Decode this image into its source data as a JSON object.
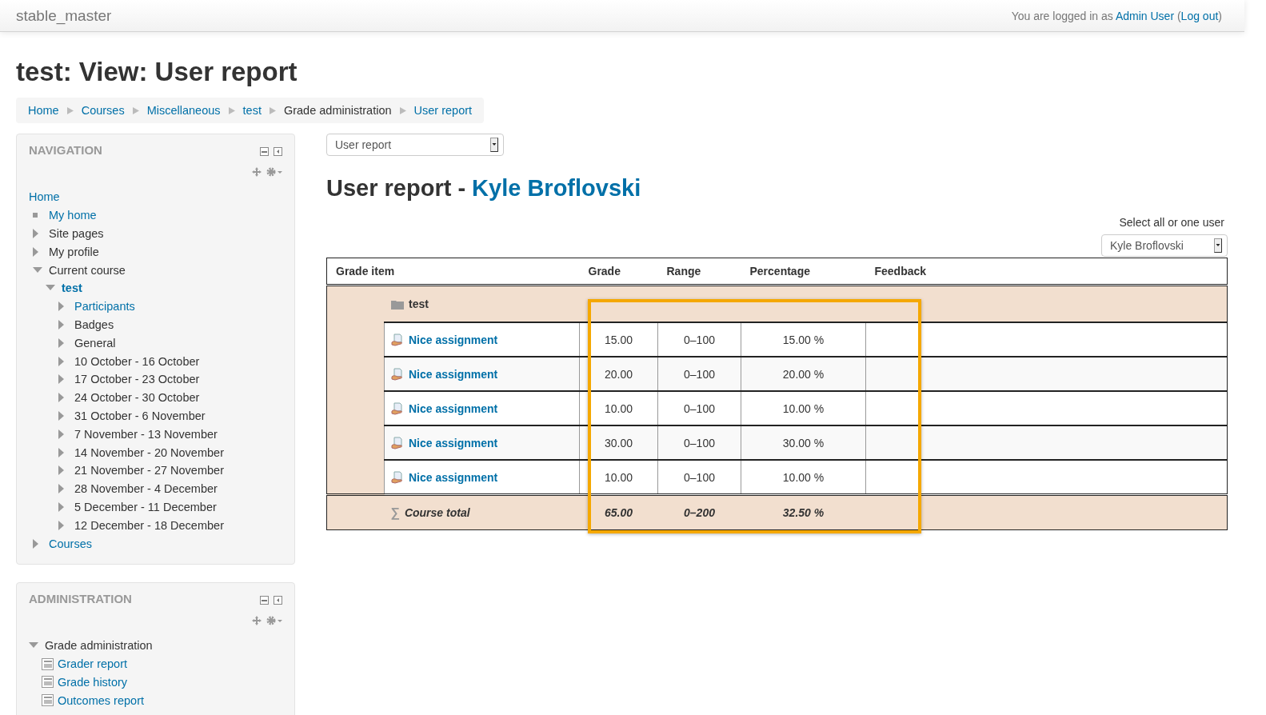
{
  "header": {
    "site_name": "stable_master",
    "login": [
      {
        "text": "You are logged in as ",
        "link": false
      },
      {
        "text": "Admin User",
        "link": true
      },
      {
        "text": " (",
        "link": false
      },
      {
        "text": "Log out",
        "link": true
      },
      {
        "text": ")",
        "link": false
      }
    ]
  },
  "page_title": "test: View: User report",
  "breadcrumb": [
    {
      "label": "Home",
      "link": true
    },
    {
      "label": "Courses",
      "link": true
    },
    {
      "label": "Miscellaneous",
      "link": true
    },
    {
      "label": "test",
      "link": true
    },
    {
      "label": "Grade administration",
      "link": false
    },
    {
      "label": "User report",
      "link": true
    }
  ],
  "blocks": [
    {
      "title": "NAVIGATION",
      "items": [
        {
          "label": "Home",
          "kind": "none",
          "link": true,
          "selected": false,
          "children": [
            {
              "label": "My home",
              "kind": "bullet",
              "link": true,
              "selected": false
            },
            {
              "label": "Site pages",
              "kind": "branch",
              "expanded": false,
              "link": false,
              "selected": false
            },
            {
              "label": "My profile",
              "kind": "branch",
              "expanded": false,
              "link": false,
              "selected": false
            },
            {
              "label": "Current course",
              "kind": "branch",
              "expanded": true,
              "link": false,
              "selected": false,
              "children": [
                {
                  "label": "test",
                  "kind": "branch",
                  "expanded": true,
                  "link": true,
                  "selected": true,
                  "children": [
                    {
                      "label": "Participants",
                      "kind": "branch",
                      "expanded": false,
                      "link": true,
                      "selected": false
                    },
                    {
                      "label": "Badges",
                      "kind": "branch",
                      "expanded": false,
                      "link": false,
                      "selected": false
                    },
                    {
                      "label": "General",
                      "kind": "branch",
                      "expanded": false,
                      "link": false,
                      "selected": false
                    },
                    {
                      "label": "10 October - 16 October",
                      "kind": "branch",
                      "expanded": false,
                      "link": false,
                      "selected": false
                    },
                    {
                      "label": "17 October - 23 October",
                      "kind": "branch",
                      "expanded": false,
                      "link": false,
                      "selected": false
                    },
                    {
                      "label": "24 October - 30 October",
                      "kind": "branch",
                      "expanded": false,
                      "link": false,
                      "selected": false
                    },
                    {
                      "label": "31 October - 6 November",
                      "kind": "branch",
                      "expanded": false,
                      "link": false,
                      "selected": false
                    },
                    {
                      "label": "7 November - 13 November",
                      "kind": "branch",
                      "expanded": false,
                      "link": false,
                      "selected": false
                    },
                    {
                      "label": "14 November - 20 November",
                      "kind": "branch",
                      "expanded": false,
                      "link": false,
                      "selected": false
                    },
                    {
                      "label": "21 November - 27 November",
                      "kind": "branch",
                      "expanded": false,
                      "link": false,
                      "selected": false
                    },
                    {
                      "label": "28 November - 4 December",
                      "kind": "branch",
                      "expanded": false,
                      "link": false,
                      "selected": false
                    },
                    {
                      "label": "5 December - 11 December",
                      "kind": "branch",
                      "expanded": false,
                      "link": false,
                      "selected": false
                    },
                    {
                      "label": "12 December - 18 December",
                      "kind": "branch",
                      "expanded": false,
                      "link": false,
                      "selected": false
                    }
                  ]
                }
              ]
            },
            {
              "label": "Courses",
              "kind": "branch",
              "expanded": false,
              "link": true,
              "selected": false
            }
          ]
        }
      ]
    },
    {
      "title": "ADMINISTRATION",
      "items": [
        {
          "label": "Grade administration",
          "kind": "branch",
          "expanded": true,
          "link": false,
          "selected": false,
          "children": [
            {
              "label": "Grader report",
              "kind": "report",
              "link": true,
              "selected": false
            },
            {
              "label": "Grade history",
              "kind": "report",
              "link": true,
              "selected": false
            },
            {
              "label": "Outcomes report",
              "kind": "report",
              "link": true,
              "selected": false
            }
          ]
        }
      ]
    }
  ],
  "report_select": {
    "value": "User report"
  },
  "report_heading": {
    "text": "User report - ",
    "user": "Kyle Broflovski"
  },
  "user_select": {
    "label": "Select all or one user",
    "value": "Kyle Broflovski"
  },
  "table": {
    "columns": [
      "Grade item",
      "Grade",
      "Range",
      "Percentage",
      "Feedback"
    ],
    "category": "test",
    "rows": [
      {
        "item": "Nice assignment",
        "grade": "15.00",
        "range": "0–100",
        "percentage": "15.00 %"
      },
      {
        "item": "Nice assignment",
        "grade": "20.00",
        "range": "0–100",
        "percentage": "20.00 %"
      },
      {
        "item": "Nice assignment",
        "grade": "10.00",
        "range": "0–100",
        "percentage": "10.00 %"
      },
      {
        "item": "Nice assignment",
        "grade": "30.00",
        "range": "0–100",
        "percentage": "30.00 %"
      },
      {
        "item": "Nice assignment",
        "grade": "10.00",
        "range": "0–100",
        "percentage": "10.00 %"
      }
    ],
    "total": {
      "symbol": "∑",
      "label": "Course total",
      "grade": "65.00",
      "range": "0–200",
      "percentage": "32.50 %"
    }
  },
  "highlight": {
    "color": "#f5a800"
  }
}
